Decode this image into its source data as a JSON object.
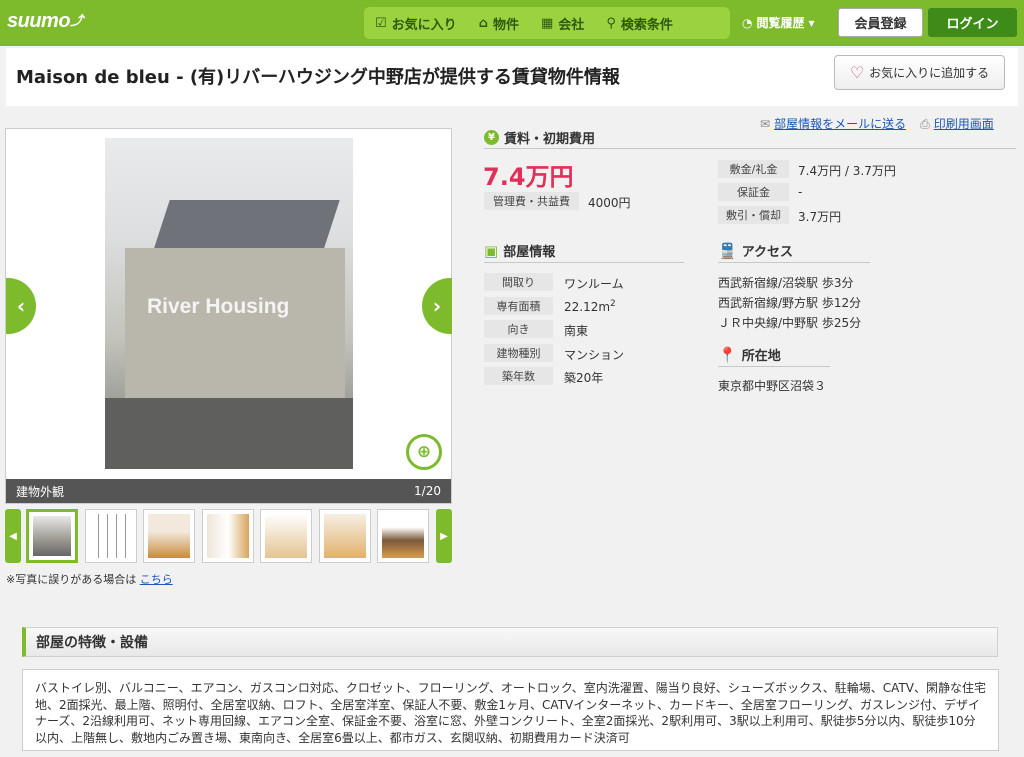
{
  "header": {
    "logo": "suumo",
    "nav": [
      {
        "icon": "check-box-icon",
        "label": "お気に入り"
      },
      {
        "icon": "home-icon",
        "label": "物件"
      },
      {
        "icon": "building-icon",
        "label": "会社"
      },
      {
        "icon": "search-icon",
        "label": "検索条件"
      }
    ],
    "history": "閲覧履歴",
    "register": "会員登録",
    "login": "ログイン"
  },
  "title": "Maison de bleu - (有)リバーハウジング中野店が提供する賃貸物件情報",
  "favorite_button": "お気に入りに追加する",
  "gallery": {
    "watermark": "River Housing",
    "caption": "建物外観",
    "counter": "1/20",
    "note": "※写真に誤りがある場合は",
    "note_link": "こちら"
  },
  "links": {
    "mail": "部屋情報をメールに送る",
    "print": "印刷用画面"
  },
  "rent_section": {
    "heading": "賃料・初期費用",
    "rent": "7.4万円",
    "mgmt_label": "管理費・共益費",
    "mgmt_value": "4000円",
    "rows": [
      {
        "label": "敷金/礼金",
        "value": "7.4万円 / 3.7万円"
      },
      {
        "label": "保証金",
        "value": "-"
      },
      {
        "label": "敷引・償却",
        "value": "3.7万円"
      }
    ]
  },
  "room_section": {
    "heading": "部屋情報",
    "rows": [
      {
        "label": "間取り",
        "value": "ワンルーム"
      },
      {
        "label": "専有面積",
        "value": "22.12m",
        "sup": "2"
      },
      {
        "label": "向き",
        "value": "南東"
      },
      {
        "label": "建物種別",
        "value": "マンション"
      },
      {
        "label": "築年数",
        "value": "築20年"
      }
    ]
  },
  "access_section": {
    "heading": "アクセス",
    "lines": [
      "西武新宿線/沼袋駅 歩3分",
      "西武新宿線/野方駅 歩12分",
      "ＪＲ中央線/中野駅 歩25分"
    ]
  },
  "location_section": {
    "heading": "所在地",
    "address": "東京都中野区沼袋３"
  },
  "features": {
    "heading": "部屋の特徴・設備",
    "text": "バストイレ別、バルコニー、エアコン、ガスコンロ対応、クロゼット、フローリング、オートロック、室内洗濯置、陽当り良好、シューズボックス、駐輪場、CATV、閑静な住宅地、2面採光、最上階、照明付、全居室収納、ロフト、全居室洋室、保証人不要、敷金1ヶ月、CATVインターネット、カードキー、全居室フローリング、ガスレンジ付、デザイナーズ、2沿線利用可、ネット専用回線、エアコン全室、保証金不要、浴室に窓、外壁コンクリート、全室2面採光、2駅利用可、3駅以上利用可、駅徒歩5分以内、駅徒歩10分以内、上階無し、敷地内ごみ置き場、東南向き、全居室6畳以上、都市ガス、玄関収納、初期費用カード決済可"
  },
  "colors": {
    "brand": "#7dbb2c",
    "rent": "#e0305a",
    "link": "#1a57b8"
  }
}
